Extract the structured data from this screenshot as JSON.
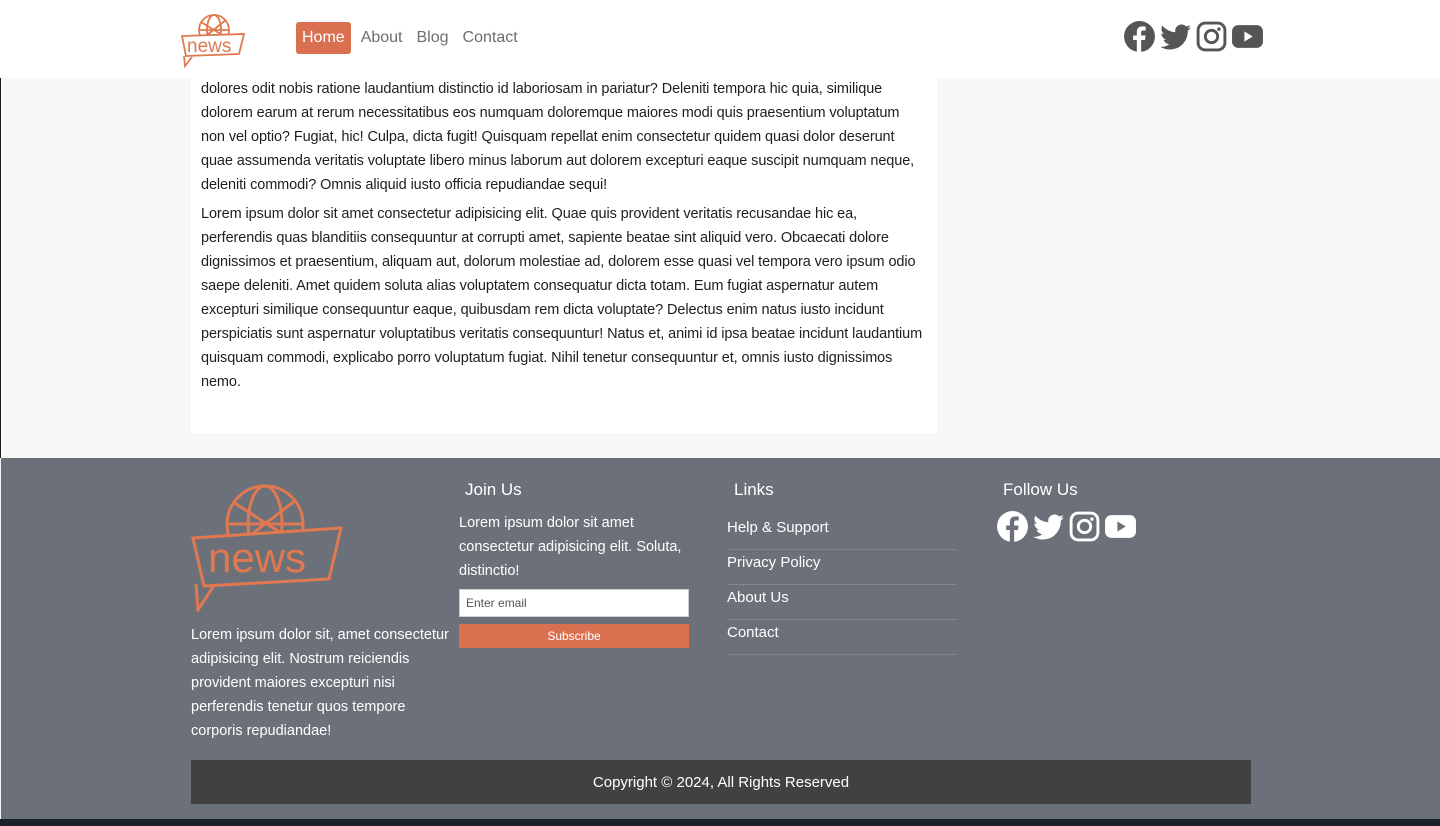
{
  "brand": {
    "logo_text": "news",
    "accent": "#d9704f",
    "icon": "globe-speech-bubble-logo"
  },
  "nav": {
    "items": [
      {
        "label": "Home",
        "active": true
      },
      {
        "label": "About",
        "active": false
      },
      {
        "label": "Blog",
        "active": false
      },
      {
        "label": "Contact",
        "active": false
      }
    ],
    "social_icons": [
      "facebook-icon",
      "twitter-icon",
      "instagram-icon",
      "youtube-icon"
    ]
  },
  "article": {
    "paragraphs": [
      "dolores odit nobis ratione laudantium distinctio id laboriosam in pariatur? Deleniti tempora hic quia, similique dolorem earum at rerum necessitatibus eos numquam doloremque maiores modi quis praesentium voluptatum non vel optio? Fugiat, hic! Culpa, dicta fugit! Quisquam repellat enim consectetur quidem quasi dolor deserunt quae assumenda veritatis voluptate libero minus laborum aut dolorem excepturi eaque suscipit numquam neque, deleniti commodi? Omnis aliquid iusto officia repudiandae sequi!",
      "Lorem ipsum dolor sit amet consectetur adipisicing elit. Quae quis provident veritatis recusandae hic ea, perferendis quas blanditiis consequuntur at corrupti amet, sapiente beatae sint aliquid vero. Obcaecati dolore dignissimos et praesentium, aliquam aut, dolorum molestiae ad, dolorem esse quasi vel tempora vero ipsum odio saepe deleniti. Amet quidem soluta alias voluptatem consequatur dicta totam. Eum fugiat aspernatur autem excepturi similique consequuntur eaque, quibusdam rem dicta voluptate? Delectus enim natus iusto incidunt perspiciatis sunt aspernatur voluptatibus veritatis consequuntur! Natus et, animi id ipsa beatae incidunt laudantium quisquam commodi, explicabo porro voluptatum fugiat. Nihil tenetur consequuntur et, omnis iusto dignissimos nemo."
    ]
  },
  "footer": {
    "about_text": "Lorem ipsum dolor sit, amet consectetur adipisicing elit. Nostrum reiciendis provident maiores excepturi nisi perferendis tenetur quos tempore corporis repudiandae!",
    "join": {
      "heading": "Join Us",
      "text": "Lorem ipsum dolor sit amet consectetur adipisicing elit. Soluta, distinctio!",
      "email_placeholder": "Enter email",
      "subscribe_label": "Subscribe"
    },
    "links": {
      "heading": "Links",
      "items": [
        "Help & Support",
        "Privacy Policy",
        "About Us",
        "Contact"
      ]
    },
    "follow": {
      "heading": "Follow Us",
      "social_icons": [
        "facebook-icon",
        "twitter-icon",
        "instagram-icon",
        "youtube-icon"
      ]
    },
    "copyright": "Copyright © 2024, All Rights Reserved",
    "background": "#6c7079"
  }
}
